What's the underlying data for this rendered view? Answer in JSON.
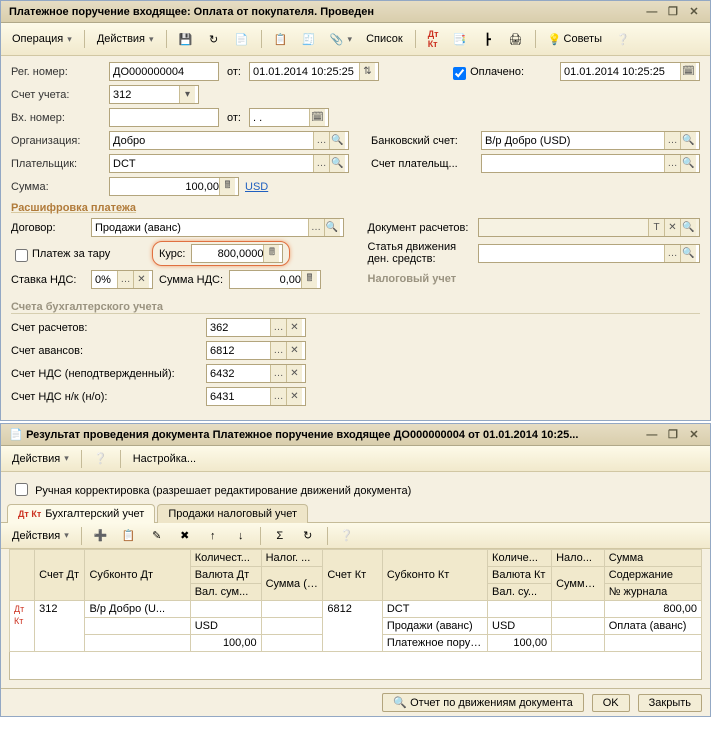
{
  "colors": {
    "accent": "#b17b3a"
  },
  "window1": {
    "title": "Платежное поручение входящее: Оплата от покупателя. Проведен",
    "toolbar": {
      "operation": "Операция",
      "actions": "Действия",
      "list": "Список",
      "tips": "Советы"
    },
    "labels": {
      "reg_number": "Рег. номер:",
      "from": "от:",
      "paid": "Оплачено:",
      "account": "Счет учета:",
      "in_number": "Вх. номер:",
      "org": "Организация:",
      "bank_acc": "Банковский счет:",
      "payer": "Плательщик:",
      "payer_acc": "Счет плательщ...",
      "sum": "Сумма:",
      "section_rasch": "Расшифровка платежа",
      "contract": "Договор:",
      "tara": "Платеж за тару",
      "rate": "Курс:",
      "vat_rate": "Ставка НДС:",
      "vat_sum": "Сумма НДС:",
      "doc_calc": "Документ расчетов:",
      "move_article": "Статья движения ден. средств:",
      "tax_acc": "Налоговый учет",
      "accounts_title": "Счета бухгалтерского учета",
      "acc_calc": "Счет расчетов:",
      "acc_advance": "Счет авансов:",
      "acc_vat_unc": "Счет НДС (неподтвержденный):",
      "acc_vat_nk": "Счет НДС н/к (н/о):"
    },
    "values": {
      "reg_number": "ДО000000004",
      "date1": "01.01.2014 10:25:25",
      "paid_date": "01.01.2014 10:25:25",
      "account": "312",
      "in_date": ". .",
      "org": "Добро",
      "bank_acc": "В/р Добро (USD)",
      "payer": "DCT",
      "sum": "100,00",
      "currency": "USD",
      "contract": "Продажи (аванс)",
      "rate": "800,0000",
      "vat_rate": "0%",
      "vat_sum": "0,00",
      "acc_calc": "362",
      "acc_advance": "6812",
      "acc_vat_unc": "6432",
      "acc_vat_nk": "6431"
    }
  },
  "window2": {
    "title": "Результат проведения документа Платежное поручение входящее ДО000000004 от 01.01.2014 10:25...",
    "toolbar": {
      "actions": "Действия",
      "settings": "Настройка..."
    },
    "manual_label": "Ручная корректировка (разрешает редактирование движений документа)",
    "tabs": {
      "t1": "Бухгалтерский учет",
      "t2": "Продажи налоговый учет"
    },
    "subtoolbar": {
      "actions": "Действия"
    },
    "headers": {
      "acc_dt": "Счет Дт",
      "sub_dt": "Субконто Дт",
      "qty": "Количест...",
      "tax": "Налог. ...",
      "acc_kt": "Счет Кт",
      "sub_kt": "Субконто Кт",
      "qty2": "Количе...",
      "tax2": "Нало...",
      "sum": "Сумма",
      "cur_dt": "Валюта Дт",
      "sum_nu_dt": "Сумма (н/у) Дт",
      "cur_kt": "Валюта Кт",
      "sum_nu_kt": "Сумма (н/у) Кт",
      "content": "Содержание",
      "valsum": "Вал. сум...",
      "valsum2": "Вал. су...",
      "journal": "№ журнала"
    },
    "row": {
      "acc_dt": "312",
      "sub_dt1": "В/р Добро (U...",
      "cur_dt": "USD",
      "valsum_dt": "100,00",
      "acc_kt": "6812",
      "sub_kt1": "DCT",
      "sub_kt2": "Продажи (аванс)",
      "sub_kt3": "Платежное поручение в...",
      "cur_kt": "USD",
      "valsum_kt": "100,00",
      "sum": "800,00",
      "content": "Оплата (аванс)"
    },
    "footer": {
      "report": "Отчет по движениям документа",
      "ok": "OK",
      "close": "Закрыть"
    }
  }
}
